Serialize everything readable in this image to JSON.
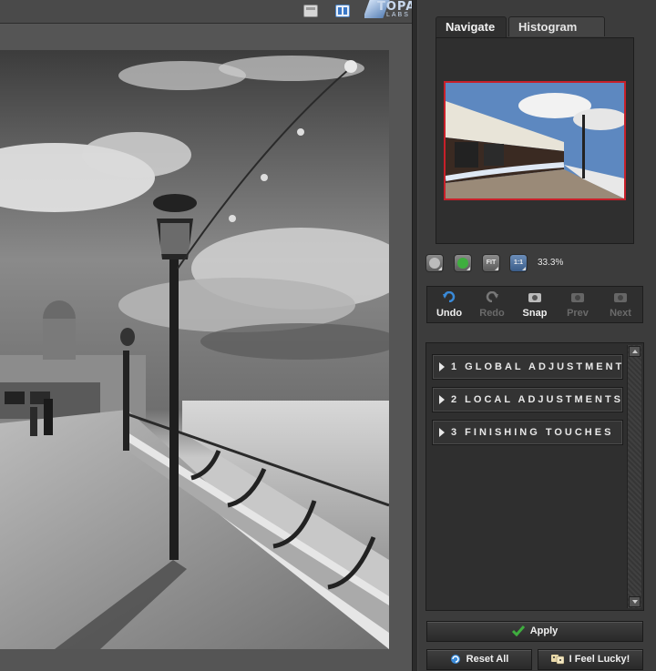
{
  "toolbar": {
    "icons": [
      "single-view-icon",
      "split-view-icon"
    ],
    "logo_text": "TOPAZ",
    "logo_sub": "LABS"
  },
  "navigator": {
    "tabs": [
      {
        "label": "Navigate",
        "active": true
      },
      {
        "label": "Histogram",
        "active": false
      }
    ],
    "viewport_color": "#c8202a"
  },
  "zoom": {
    "buttons": [
      {
        "name": "zoom-out",
        "icon": "minus-icon"
      },
      {
        "name": "zoom-in",
        "icon": "plus-icon"
      },
      {
        "name": "zoom-fit",
        "label": "FIT"
      },
      {
        "name": "zoom-1-1",
        "label": "1:1"
      }
    ],
    "level": "33.3%"
  },
  "tools": [
    {
      "label": "Undo",
      "icon": "undo-icon",
      "enabled": true
    },
    {
      "label": "Redo",
      "icon": "redo-icon",
      "enabled": false
    },
    {
      "label": "Snap",
      "icon": "camera-icon",
      "enabled": true
    },
    {
      "label": "Prev",
      "icon": "camera-icon",
      "enabled": false
    },
    {
      "label": "Next",
      "icon": "camera-icon",
      "enabled": false
    }
  ],
  "sections": [
    {
      "label": "1 GLOBAL ADJUSTMENT"
    },
    {
      "label": "2 LOCAL ADJUSTMENTS"
    },
    {
      "label": "3 FINISHING TOUCHES"
    }
  ],
  "actions": {
    "apply": "Apply",
    "reset": "Reset All",
    "lucky": "I Feel Lucky!"
  },
  "colors": {
    "accent_green": "#3fae3f",
    "undo_blue": "#3a8ad8"
  }
}
